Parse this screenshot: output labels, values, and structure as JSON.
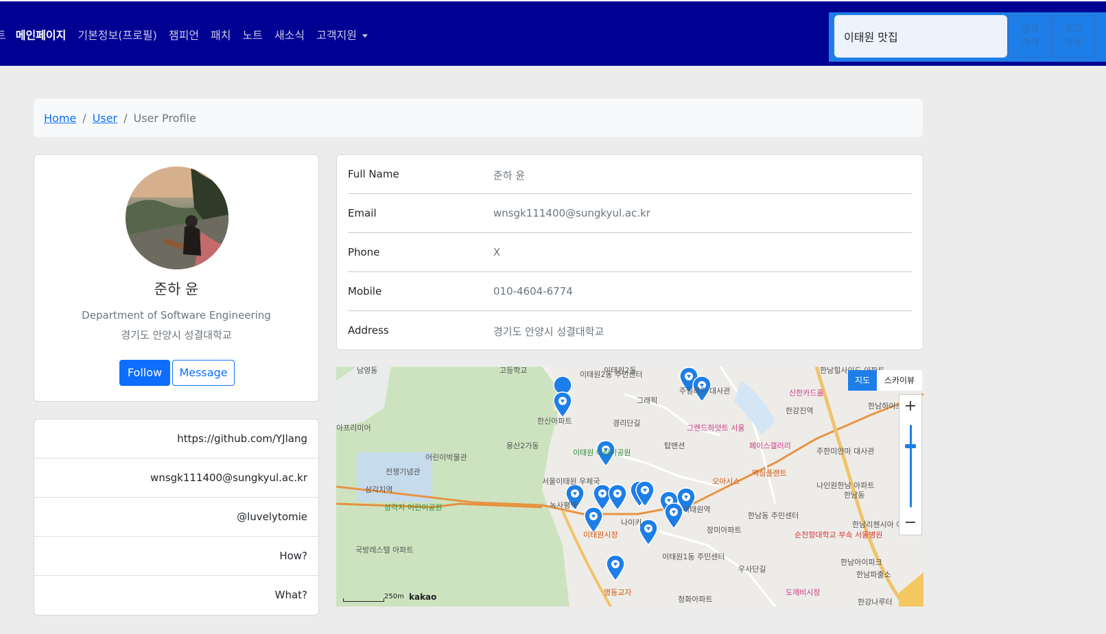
{
  "nav": {
    "cut_item": "트",
    "items": [
      "메인페이지",
      "기본정보(프로필)",
      "챔피언",
      "패치",
      "노트",
      "새소식",
      "고객지원"
    ],
    "search_value": "이태원 맛집",
    "search_button": "검색\n하기",
    "logout_button": "로그\n아웃",
    "brand_color": "#000093"
  },
  "breadcrumb": {
    "home": "Home",
    "user": "User",
    "current": "User Profile"
  },
  "profile": {
    "name": "준하 윤",
    "department": "Department of Software Engineering",
    "location": "경기도 안양시 성결대학교",
    "follow_label": "Follow",
    "message_label": "Message"
  },
  "links": [
    "https://github.com/YJlang",
    "wnsgk111400@sungkyul.ac.kr",
    "@luvelytomie",
    "How?",
    "What?"
  ],
  "info": {
    "full_name_label": "Full Name",
    "full_name": "준하 윤",
    "email_label": "Email",
    "email": "wnsgk111400@sungkyul.ac.kr",
    "phone_label": "Phone",
    "phone": "X",
    "mobile_label": "Mobile",
    "mobile": "010-4604-6774",
    "address_label": "Address",
    "address": "경기도 안양시 성결대학교"
  },
  "map": {
    "type_map": "지도",
    "type_sky": "스카이뷰",
    "zoom_in": "+",
    "zoom_out": "−",
    "scale": "250m",
    "attribution": "kakao",
    "labels": [
      "이태원2동 주민센터",
      "이태원2동",
      "그래픽",
      "주필리핀 대사관",
      "한남힐사이드 아파트",
      "신한카드홀",
      "한강진역",
      "한남하이츠",
      "한신아파트",
      "경리단길",
      "그랜드하얏트 서울",
      "페이스갤러리",
      "주한미얀마 대사관",
      "용산2가동",
      "이태원 어린이공원",
      "탑맨션",
      "전쟁기념관",
      "어린이박물관",
      "서울이태원 우체국",
      "오아시스",
      "맥심플랜트",
      "나인원한남 아파트",
      "한남동",
      "삼각지역",
      "녹사평역",
      "이태원역",
      "한남동 주민센터",
      "삼각지 어린이공원",
      "이태원시장",
      "나이키",
      "장미아파트",
      "순천향대학교 부속 서울병원",
      "한남리첸시아 아파트",
      "국방레스텔 아파트",
      "이태원1동 주민센터",
      "한남아이파크",
      "한남파출소",
      "우사단길",
      "명동교자",
      "청화아파트",
      "도깨비시장",
      "남영동",
      "한강나루터",
      "아프리미어",
      "고등학교"
    ]
  }
}
